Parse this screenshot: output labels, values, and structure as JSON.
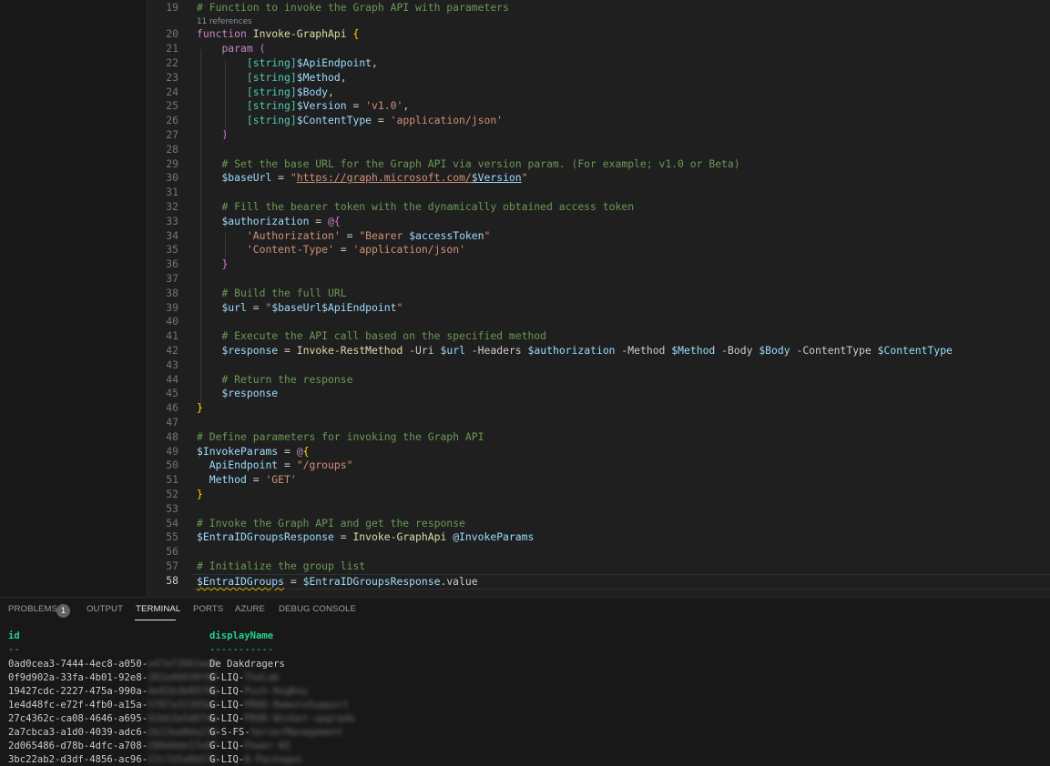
{
  "editor": {
    "references_label": "11 references",
    "current_line": 58,
    "lines": [
      {
        "n": 19,
        "tokens": [
          [
            "c",
            "# Function to invoke the Graph API with parameters"
          ]
        ]
      },
      {
        "n": 20,
        "tokens": [
          [
            "k",
            "function "
          ],
          [
            "f",
            "Invoke-GraphApi "
          ],
          [
            "b1",
            "{"
          ]
        ]
      },
      {
        "n": 21,
        "tokens": [
          [
            "p",
            "    "
          ],
          [
            "k",
            "param "
          ],
          [
            "b2",
            "("
          ]
        ]
      },
      {
        "n": 22,
        "tokens": [
          [
            "p",
            "        "
          ],
          [
            "t",
            "[string]"
          ],
          [
            "v",
            "$ApiEndpoint"
          ],
          [
            "p",
            ","
          ]
        ]
      },
      {
        "n": 23,
        "tokens": [
          [
            "p",
            "        "
          ],
          [
            "t",
            "[string]"
          ],
          [
            "v",
            "$Method"
          ],
          [
            "p",
            ","
          ]
        ]
      },
      {
        "n": 24,
        "tokens": [
          [
            "p",
            "        "
          ],
          [
            "t",
            "[string]"
          ],
          [
            "v",
            "$Body"
          ],
          [
            "p",
            ","
          ]
        ]
      },
      {
        "n": 25,
        "tokens": [
          [
            "p",
            "        "
          ],
          [
            "t",
            "[string]"
          ],
          [
            "v",
            "$Version"
          ],
          [
            "p",
            " = "
          ],
          [
            "s",
            "'v1.0'"
          ],
          [
            "p",
            ","
          ]
        ]
      },
      {
        "n": 26,
        "tokens": [
          [
            "p",
            "        "
          ],
          [
            "t",
            "[string]"
          ],
          [
            "v",
            "$ContentType"
          ],
          [
            "p",
            " = "
          ],
          [
            "s",
            "'application/json'"
          ]
        ]
      },
      {
        "n": 27,
        "tokens": [
          [
            "p",
            "    "
          ],
          [
            "b2",
            ")"
          ]
        ]
      },
      {
        "n": 28,
        "tokens": []
      },
      {
        "n": 29,
        "tokens": [
          [
            "p",
            "    "
          ],
          [
            "c",
            "# Set the base URL for the Graph API via version param. (For example; v1.0 or Beta)"
          ]
        ]
      },
      {
        "n": 30,
        "tokens": [
          [
            "p",
            "    "
          ],
          [
            "v",
            "$baseUrl"
          ],
          [
            "p",
            " = "
          ],
          [
            "s",
            "\""
          ],
          [
            "su",
            "https://graph.microsoft.com/"
          ],
          [
            "vu",
            "$Version"
          ],
          [
            "s",
            "\""
          ]
        ]
      },
      {
        "n": 31,
        "tokens": []
      },
      {
        "n": 32,
        "tokens": [
          [
            "p",
            "    "
          ],
          [
            "c",
            "# Fill the bearer token with the dynamically obtained access token"
          ]
        ]
      },
      {
        "n": 33,
        "tokens": [
          [
            "p",
            "    "
          ],
          [
            "v",
            "$authorization"
          ],
          [
            "p",
            " = "
          ],
          [
            "k",
            "@"
          ],
          [
            "b2",
            "{"
          ]
        ]
      },
      {
        "n": 34,
        "tokens": [
          [
            "p",
            "        "
          ],
          [
            "s",
            "'Authorization'"
          ],
          [
            "p",
            " = "
          ],
          [
            "s",
            "\"Bearer "
          ],
          [
            "v",
            "$accessToken"
          ],
          [
            "s",
            "\""
          ]
        ]
      },
      {
        "n": 35,
        "tokens": [
          [
            "p",
            "        "
          ],
          [
            "s",
            "'Content-Type'"
          ],
          [
            "p",
            " = "
          ],
          [
            "s",
            "'application/json'"
          ]
        ]
      },
      {
        "n": 36,
        "tokens": [
          [
            "p",
            "    "
          ],
          [
            "b2",
            "}"
          ]
        ]
      },
      {
        "n": 37,
        "tokens": []
      },
      {
        "n": 38,
        "tokens": [
          [
            "p",
            "    "
          ],
          [
            "c",
            "# Build the full URL"
          ]
        ]
      },
      {
        "n": 39,
        "tokens": [
          [
            "p",
            "    "
          ],
          [
            "v",
            "$url"
          ],
          [
            "p",
            " = "
          ],
          [
            "s",
            "\""
          ],
          [
            "v",
            "$baseUrl$ApiEndpoint"
          ],
          [
            "s",
            "\""
          ]
        ]
      },
      {
        "n": 40,
        "tokens": []
      },
      {
        "n": 41,
        "tokens": [
          [
            "p",
            "    "
          ],
          [
            "c",
            "# Execute the API call based on the specified method"
          ]
        ]
      },
      {
        "n": 42,
        "tokens": [
          [
            "p",
            "    "
          ],
          [
            "v",
            "$response"
          ],
          [
            "p",
            " = "
          ],
          [
            "f",
            "Invoke-RestMethod "
          ],
          [
            "p",
            "-Uri "
          ],
          [
            "v",
            "$url "
          ],
          [
            "p",
            "-Headers "
          ],
          [
            "v",
            "$authorization "
          ],
          [
            "p",
            "-Method "
          ],
          [
            "v",
            "$Method "
          ],
          [
            "p",
            "-Body "
          ],
          [
            "v",
            "$Body "
          ],
          [
            "p",
            "-ContentType "
          ],
          [
            "v",
            "$ContentType"
          ]
        ]
      },
      {
        "n": 43,
        "tokens": []
      },
      {
        "n": 44,
        "tokens": [
          [
            "p",
            "    "
          ],
          [
            "c",
            "# Return the response"
          ]
        ]
      },
      {
        "n": 45,
        "tokens": [
          [
            "p",
            "    "
          ],
          [
            "v",
            "$response"
          ]
        ]
      },
      {
        "n": 46,
        "tokens": [
          [
            "b1",
            "}"
          ]
        ]
      },
      {
        "n": 47,
        "tokens": []
      },
      {
        "n": 48,
        "tokens": [
          [
            "c",
            "# Define parameters for invoking the Graph API"
          ]
        ]
      },
      {
        "n": 49,
        "tokens": [
          [
            "v",
            "$InvokeParams"
          ],
          [
            "p",
            " = "
          ],
          [
            "k",
            "@"
          ],
          [
            "b1",
            "{"
          ]
        ]
      },
      {
        "n": 50,
        "tokens": [
          [
            "p",
            "  "
          ],
          [
            "v",
            "ApiEndpoint"
          ],
          [
            "p",
            " = "
          ],
          [
            "s",
            "\"/groups\""
          ]
        ]
      },
      {
        "n": 51,
        "tokens": [
          [
            "p",
            "  "
          ],
          [
            "v",
            "Method"
          ],
          [
            "p",
            " = "
          ],
          [
            "s",
            "'GET'"
          ]
        ]
      },
      {
        "n": 52,
        "tokens": [
          [
            "b1",
            "}"
          ]
        ]
      },
      {
        "n": 53,
        "tokens": []
      },
      {
        "n": 54,
        "tokens": [
          [
            "c",
            "# Invoke the Graph API and get the response"
          ]
        ]
      },
      {
        "n": 55,
        "tokens": [
          [
            "v",
            "$EntraIDGroupsResponse"
          ],
          [
            "p",
            " = "
          ],
          [
            "f",
            "Invoke-GraphApi "
          ],
          [
            "v",
            "@InvokeParams"
          ]
        ]
      },
      {
        "n": 56,
        "tokens": []
      },
      {
        "n": 57,
        "tokens": [
          [
            "c",
            "# Initialize the group list"
          ]
        ]
      },
      {
        "n": 58,
        "tokens": [
          [
            "vq",
            "$EntraIDGroups"
          ],
          [
            "p",
            " = "
          ],
          [
            "v",
            "$EntraIDGroupsResponse"
          ],
          [
            "p",
            ".value"
          ]
        ]
      }
    ]
  },
  "panel": {
    "tabs": [
      {
        "key": "problems",
        "label": "PROBLEMS",
        "active": false
      },
      {
        "key": "output",
        "label": "OUTPUT",
        "active": false
      },
      {
        "key": "terminal",
        "label": "TERMINAL",
        "active": true
      },
      {
        "key": "ports",
        "label": "PORTS",
        "active": false
      },
      {
        "key": "azure",
        "label": "AZURE",
        "active": false
      },
      {
        "key": "debug-console",
        "label": "DEBUG CONSOLE",
        "active": false
      }
    ],
    "problems_count": "1"
  },
  "terminal": {
    "headers": {
      "id": "id",
      "displayName": "displayName"
    },
    "separators": {
      "id": "--",
      "displayName": "-----------"
    },
    "rows": [
      {
        "id": "0ad0cea3-7444-4ec8-a050-",
        "id_blurred": "e47ef3961ee8",
        "name": "De Dakdragers",
        "name_blurred": ""
      },
      {
        "id": "0f9d902a-33fa-4b01-92e8-",
        "id_blurred": "382a46650f09",
        "name": "G-LIQ-",
        "name_blurred": "TheLab"
      },
      {
        "id": "19427cdc-2227-475a-990a-",
        "id_blurred": "4e92b3b89705",
        "name": "G-LIQ-",
        "name_blurred": "Push-RegKey"
      },
      {
        "id": "1e4d48fc-e72f-4fb0-a15a-",
        "id_blurred": "5787a32395bc",
        "name": "G-LIQ-",
        "name_blurred": "PROD-RemoteSupport"
      },
      {
        "id": "27c4362c-ca08-4646-a695-",
        "id_blurred": "92bb3a5d874e",
        "name": "G-LIQ-",
        "name_blurred": "PROD-WinGet-upgrade"
      },
      {
        "id": "2a7cbca3-a1d0-4039-adc6-",
        "id_blurred": "2b13ea8da23d",
        "name": "G-S-FS-",
        "name_blurred": "ServerManagement"
      },
      {
        "id": "2d065486-d78b-4dfc-a708-",
        "id_blurred": "289d4de17e8f",
        "name": "G-LIQ-",
        "name_blurred": "Power-BI"
      },
      {
        "id": "3bc22ab2-d3df-4856-ac96-",
        "id_blurred": "23c7e5a9b576",
        "name": "G-LIQ-",
        "name_blurred": "B-Packages"
      }
    ]
  }
}
